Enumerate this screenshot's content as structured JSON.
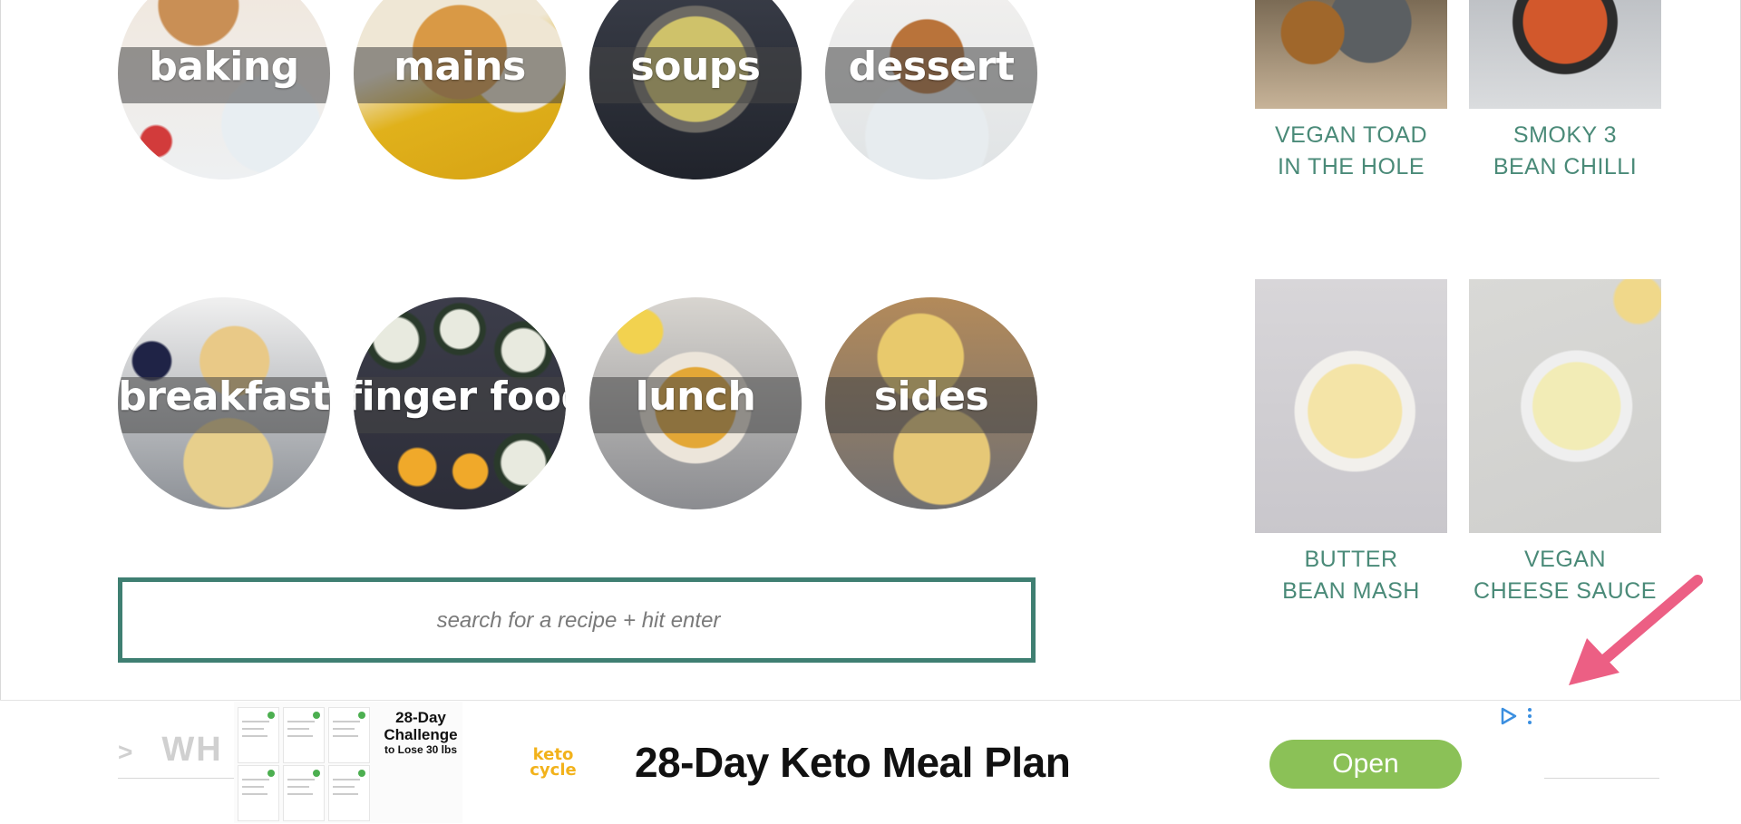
{
  "categories": [
    {
      "label": "baking"
    },
    {
      "label": "mains"
    },
    {
      "label": "soups"
    },
    {
      "label": "dessert"
    },
    {
      "label": "breakfast"
    },
    {
      "label": "finger food"
    },
    {
      "label": "lunch"
    },
    {
      "label": "sides"
    }
  ],
  "search": {
    "placeholder": "search for a recipe + hit enter"
  },
  "recipes": [
    {
      "title_line1": "VEGAN TOAD",
      "title_line2": "IN THE HOLE"
    },
    {
      "title_line1": "SMOKY 3",
      "title_line2": "BEAN CHILLI"
    },
    {
      "title_line1": "BUTTER",
      "title_line2": "BEAN MASH"
    },
    {
      "title_line1": "VEGAN",
      "title_line2": "CHEESE SAUCE"
    }
  ],
  "section_heading": {
    "chevron": ">",
    "text": "WH"
  },
  "ad": {
    "challenge_line1": "28-Day",
    "challenge_line2": "Challenge",
    "challenge_line3": "to Lose 30 lbs",
    "brand_line1": "keto",
    "brand_line2": "cycle",
    "title": "28-Day Keto Meal Plan",
    "cta": "Open"
  },
  "colors": {
    "accent": "#3f7f72",
    "recipe_title": "#4a8a78",
    "cta_green": "#8bc157",
    "annotation_arrow": "#ec5f84"
  }
}
